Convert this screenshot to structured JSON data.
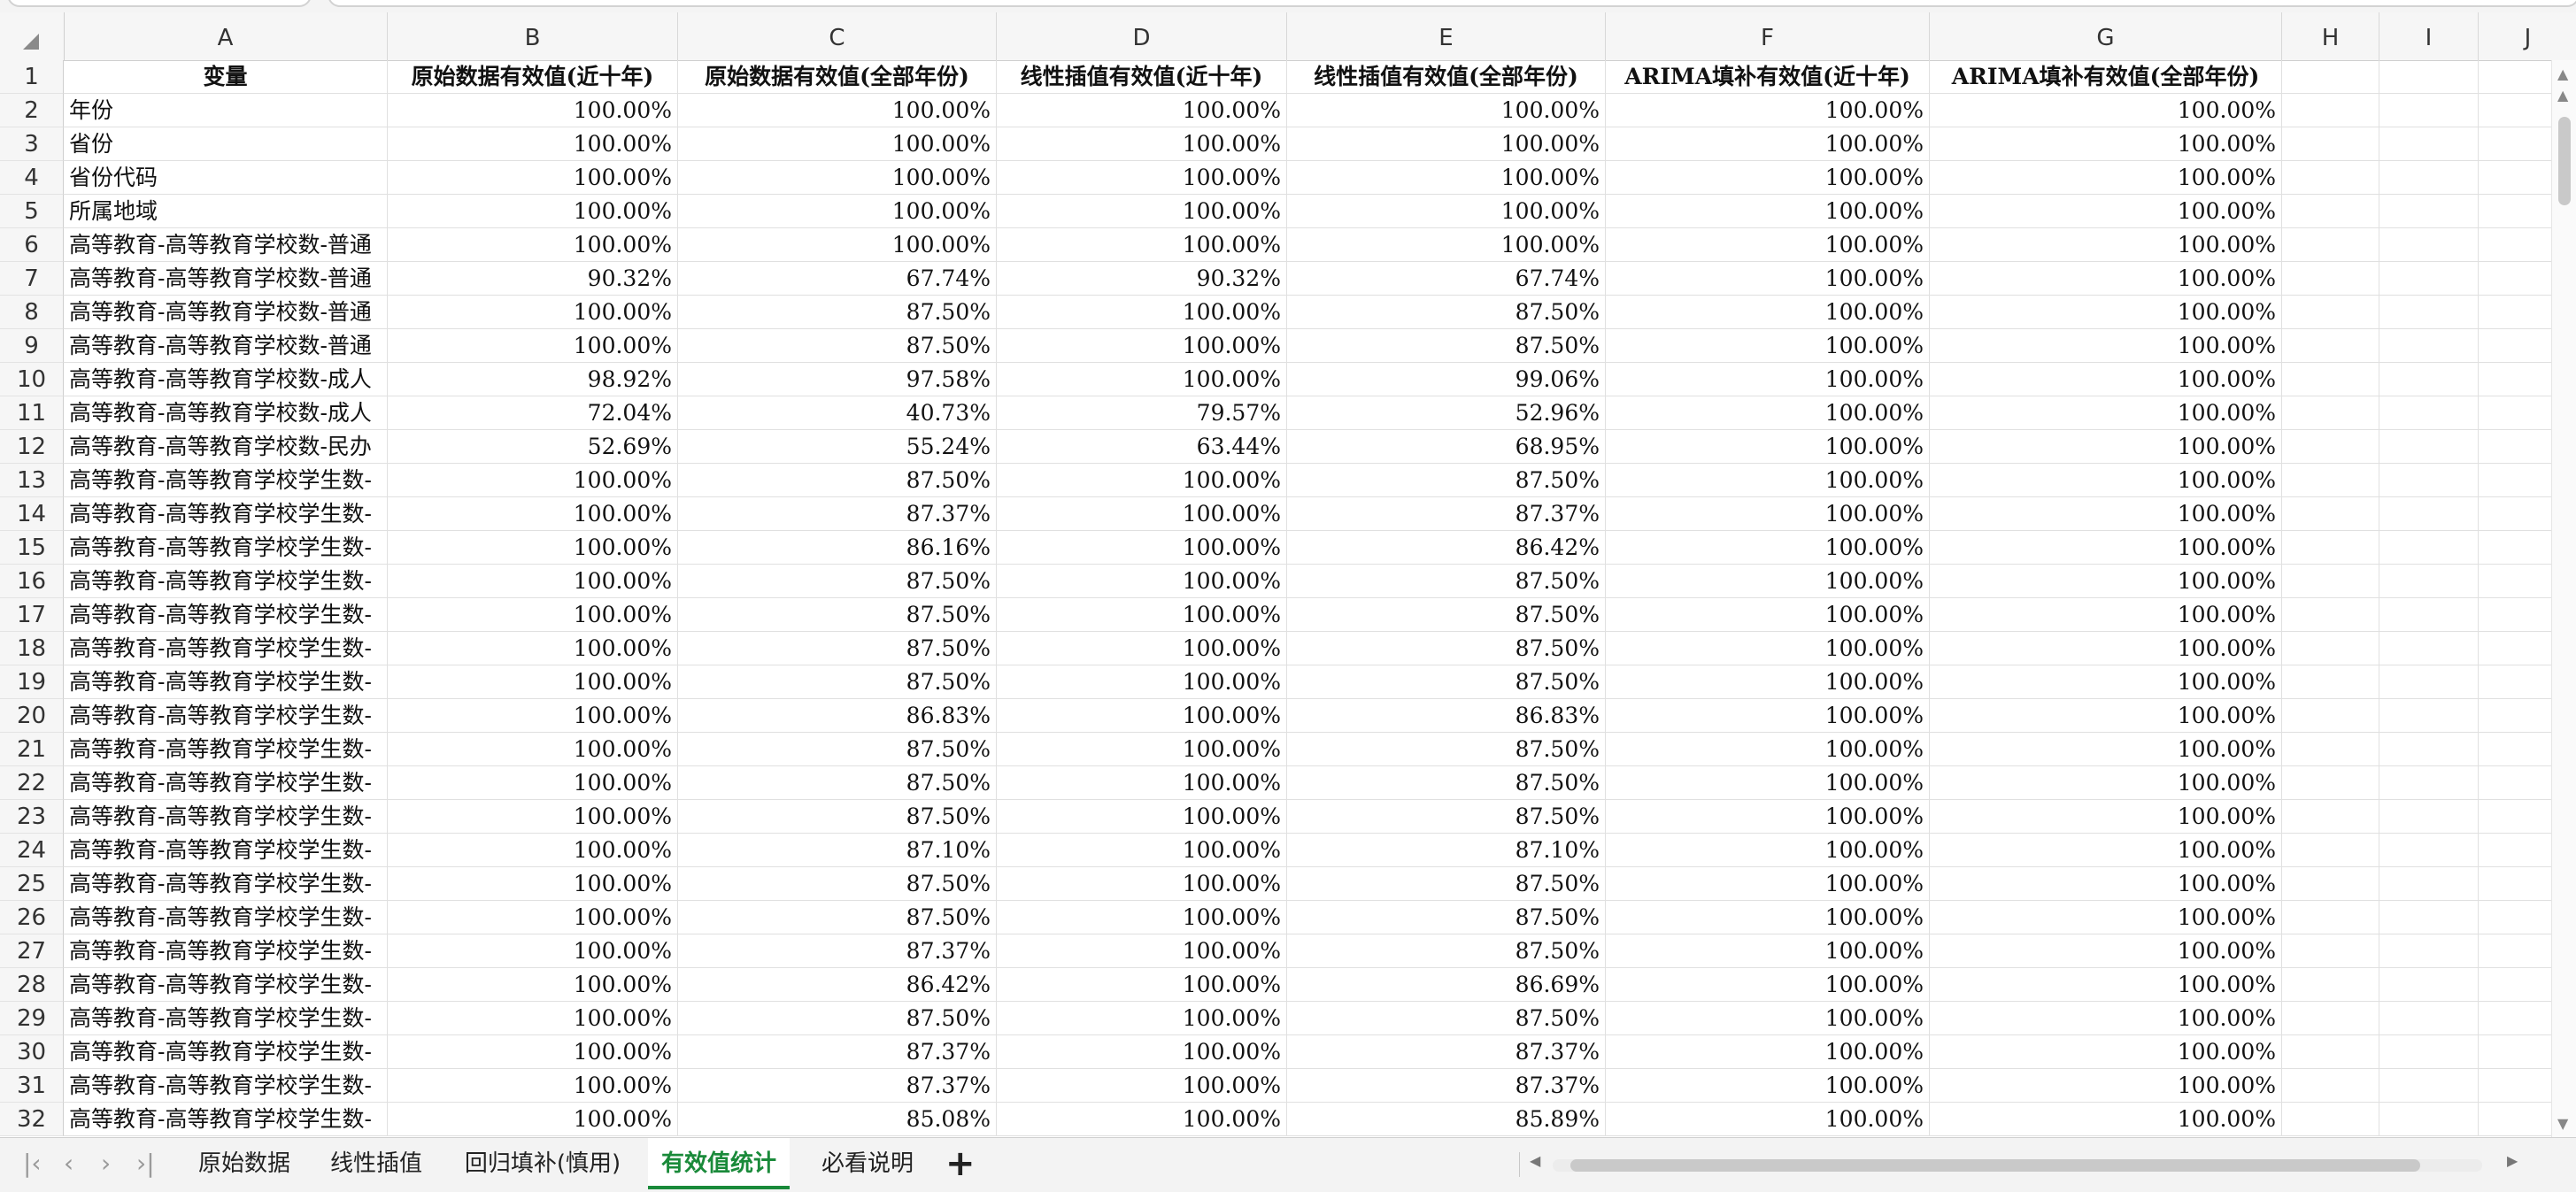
{
  "columns": [
    "A",
    "B",
    "C",
    "D",
    "E",
    "F",
    "G",
    "H",
    "I",
    "J"
  ],
  "header_row": [
    "变量",
    "原始数据有效值(近十年)",
    "原始数据有效值(全部年份)",
    "线性插值有效值(近十年)",
    "线性插值有效值(全部年份)",
    "ARIMA填补有效值(近十年)",
    "ARIMA填补有效值(全部年份)"
  ],
  "rows": [
    [
      "年份",
      "100.00%",
      "100.00%",
      "100.00%",
      "100.00%",
      "100.00%",
      "100.00%"
    ],
    [
      "省份",
      "100.00%",
      "100.00%",
      "100.00%",
      "100.00%",
      "100.00%",
      "100.00%"
    ],
    [
      "省份代码",
      "100.00%",
      "100.00%",
      "100.00%",
      "100.00%",
      "100.00%",
      "100.00%"
    ],
    [
      "所属地域",
      "100.00%",
      "100.00%",
      "100.00%",
      "100.00%",
      "100.00%",
      "100.00%"
    ],
    [
      "高等教育-高等教育学校数-普通",
      "100.00%",
      "100.00%",
      "100.00%",
      "100.00%",
      "100.00%",
      "100.00%"
    ],
    [
      "高等教育-高等教育学校数-普通",
      "90.32%",
      "67.74%",
      "90.32%",
      "67.74%",
      "100.00%",
      "100.00%"
    ],
    [
      "高等教育-高等教育学校数-普通",
      "100.00%",
      "87.50%",
      "100.00%",
      "87.50%",
      "100.00%",
      "100.00%"
    ],
    [
      "高等教育-高等教育学校数-普通",
      "100.00%",
      "87.50%",
      "100.00%",
      "87.50%",
      "100.00%",
      "100.00%"
    ],
    [
      "高等教育-高等教育学校数-成人",
      "98.92%",
      "97.58%",
      "100.00%",
      "99.06%",
      "100.00%",
      "100.00%"
    ],
    [
      "高等教育-高等教育学校数-成人",
      "72.04%",
      "40.73%",
      "79.57%",
      "52.96%",
      "100.00%",
      "100.00%"
    ],
    [
      "高等教育-高等教育学校数-民办",
      "52.69%",
      "55.24%",
      "63.44%",
      "68.95%",
      "100.00%",
      "100.00%"
    ],
    [
      "高等教育-高等教育学校学生数-",
      "100.00%",
      "87.50%",
      "100.00%",
      "87.50%",
      "100.00%",
      "100.00%"
    ],
    [
      "高等教育-高等教育学校学生数-",
      "100.00%",
      "87.37%",
      "100.00%",
      "87.37%",
      "100.00%",
      "100.00%"
    ],
    [
      "高等教育-高等教育学校学生数-",
      "100.00%",
      "86.16%",
      "100.00%",
      "86.42%",
      "100.00%",
      "100.00%"
    ],
    [
      "高等教育-高等教育学校学生数-",
      "100.00%",
      "87.50%",
      "100.00%",
      "87.50%",
      "100.00%",
      "100.00%"
    ],
    [
      "高等教育-高等教育学校学生数-",
      "100.00%",
      "87.50%",
      "100.00%",
      "87.50%",
      "100.00%",
      "100.00%"
    ],
    [
      "高等教育-高等教育学校学生数-",
      "100.00%",
      "87.50%",
      "100.00%",
      "87.50%",
      "100.00%",
      "100.00%"
    ],
    [
      "高等教育-高等教育学校学生数-",
      "100.00%",
      "87.50%",
      "100.00%",
      "87.50%",
      "100.00%",
      "100.00%"
    ],
    [
      "高等教育-高等教育学校学生数-",
      "100.00%",
      "86.83%",
      "100.00%",
      "86.83%",
      "100.00%",
      "100.00%"
    ],
    [
      "高等教育-高等教育学校学生数-",
      "100.00%",
      "87.50%",
      "100.00%",
      "87.50%",
      "100.00%",
      "100.00%"
    ],
    [
      "高等教育-高等教育学校学生数-",
      "100.00%",
      "87.50%",
      "100.00%",
      "87.50%",
      "100.00%",
      "100.00%"
    ],
    [
      "高等教育-高等教育学校学生数-",
      "100.00%",
      "87.50%",
      "100.00%",
      "87.50%",
      "100.00%",
      "100.00%"
    ],
    [
      "高等教育-高等教育学校学生数-",
      "100.00%",
      "87.10%",
      "100.00%",
      "87.10%",
      "100.00%",
      "100.00%"
    ],
    [
      "高等教育-高等教育学校学生数-",
      "100.00%",
      "87.50%",
      "100.00%",
      "87.50%",
      "100.00%",
      "100.00%"
    ],
    [
      "高等教育-高等教育学校学生数-",
      "100.00%",
      "87.50%",
      "100.00%",
      "87.50%",
      "100.00%",
      "100.00%"
    ],
    [
      "高等教育-高等教育学校学生数-",
      "100.00%",
      "87.37%",
      "100.00%",
      "87.50%",
      "100.00%",
      "100.00%"
    ],
    [
      "高等教育-高等教育学校学生数-",
      "100.00%",
      "86.42%",
      "100.00%",
      "86.69%",
      "100.00%",
      "100.00%"
    ],
    [
      "高等教育-高等教育学校学生数-",
      "100.00%",
      "87.50%",
      "100.00%",
      "87.50%",
      "100.00%",
      "100.00%"
    ],
    [
      "高等教育-高等教育学校学生数-",
      "100.00%",
      "87.37%",
      "100.00%",
      "87.37%",
      "100.00%",
      "100.00%"
    ],
    [
      "高等教育-高等教育学校学生数-",
      "100.00%",
      "87.37%",
      "100.00%",
      "87.37%",
      "100.00%",
      "100.00%"
    ],
    [
      "高等教育-高等教育学校学生数-",
      "100.00%",
      "85.08%",
      "100.00%",
      "85.89%",
      "100.00%",
      "100.00%"
    ]
  ],
  "sheet_tabs": [
    "原始数据",
    "线性插值",
    "回归填补(慎用)",
    "有效值统计",
    "必看说明"
  ],
  "active_tab": "有效值统计",
  "icons": {
    "first_sheet": "first-sheet-icon",
    "prev_sheet": "prev-sheet-icon",
    "next_sheet": "next-sheet-icon",
    "last_sheet": "last-sheet-icon",
    "add_sheet": "add-sheet-icon",
    "select_all": "select-all-icon"
  },
  "colors": {
    "active_tab": "#1a8a3a",
    "grid_line": "#e0e0e0",
    "header_bg": "#f6f6f6"
  }
}
